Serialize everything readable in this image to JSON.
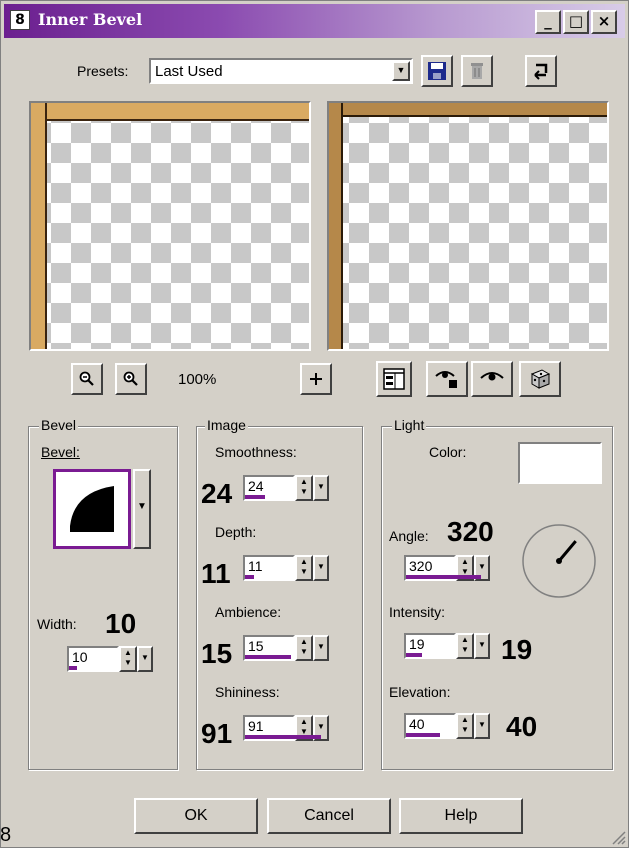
{
  "title_bar": {
    "app_icon_text": "8",
    "title": "Inner Bevel",
    "minimize_label": "_",
    "maximize_label": "□",
    "close_label": "×"
  },
  "presets": {
    "label": "Presets:",
    "value": "Last Used"
  },
  "zoom": {
    "level": "100%"
  },
  "bevel_group": {
    "title": "Bevel",
    "bevel_label": "Bevel:",
    "width_label": "Width:",
    "width_display": "10",
    "width_value": "10",
    "width_fraction": 0.1
  },
  "image_group": {
    "title": "Image",
    "smoothness_label": "Smoothness:",
    "smoothness_display": "24",
    "smoothness_value": "24",
    "smoothness_fraction": 0.24,
    "depth_label": "Depth:",
    "depth_display": "11",
    "depth_value": "11",
    "depth_fraction": 0.11,
    "ambience_label": "Ambience:",
    "ambience_display": "15",
    "ambience_value": "15",
    "ambience_fraction": 0.55,
    "shininess_label": "Shininess:",
    "shininess_display": "91",
    "shininess_value": "91",
    "shininess_fraction": 0.91
  },
  "light_group": {
    "title": "Light",
    "color_label": "Color:",
    "color_value": "#ffffff",
    "angle_label": "Angle:",
    "angle_display": "320",
    "angle_value": "320",
    "angle_degrees": 320,
    "intensity_label": "Intensity:",
    "intensity_display": "19",
    "intensity_value": "19",
    "intensity_fraction": 0.19,
    "elevation_label": "Elevation:",
    "elevation_display": "40",
    "elevation_value": "40",
    "elevation_fraction": 0.4
  },
  "buttons": {
    "ok": "OK",
    "cancel": "Cancel",
    "help": "Help"
  },
  "stray_char": "8",
  "colors": {
    "title_gradient_start": "#6b1f8f",
    "accent_bar": "#7a1b92",
    "face": "#d4d0c8"
  }
}
